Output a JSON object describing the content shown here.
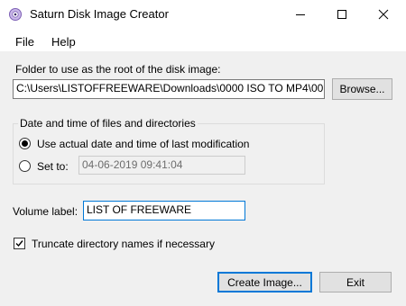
{
  "window": {
    "title": "Saturn Disk Image Creator"
  },
  "menu": {
    "file": "File",
    "help": "Help"
  },
  "folder": {
    "label": "Folder to use as the root of the disk image:",
    "value": "C:\\Users\\LISTOFFREEWARE\\Downloads\\0000 ISO TO MP4\\00",
    "browse_label": "Browse..."
  },
  "datetime": {
    "group_title": "Date and time of files and directories",
    "option_actual": "Use actual date and time of last modification",
    "option_set": "Set to:",
    "set_value": "04-06-2019 09:41:04",
    "selected": "actual"
  },
  "volume": {
    "label": "Volume label:",
    "value": "LIST OF FREEWARE"
  },
  "truncate": {
    "label": "Truncate directory names if necessary",
    "checked": true
  },
  "actions": {
    "create_label": "Create Image...",
    "exit_label": "Exit"
  },
  "colors": {
    "accent": "#0078d7",
    "window_bg": "#f0f0f0"
  }
}
